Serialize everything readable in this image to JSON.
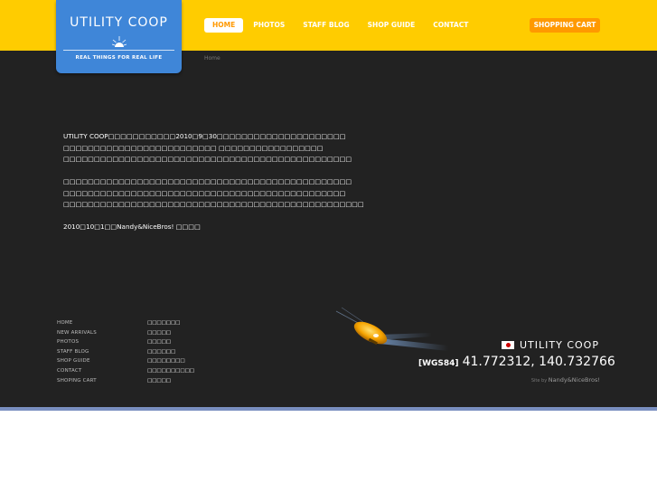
{
  "logo": {
    "title": "UTILITY COOP",
    "tagline": "REAL THINGS FOR REAL LIFE"
  },
  "nav": {
    "items": [
      {
        "label": "HOME",
        "active": true
      },
      {
        "label": "PHOTOS",
        "active": false
      },
      {
        "label": "STAFF BLOG",
        "active": false
      },
      {
        "label": "SHOP GUIDE",
        "active": false
      },
      {
        "label": "CONTACT",
        "active": false
      }
    ],
    "cart_label": "SHOPPING CART"
  },
  "breadcrumb": "Home",
  "content": {
    "lines": [
      "UTILITY COOP□□□□□□□□□□□2010□9□30□□□□□□□□□□□□□□□□□□□□□",
      "□□□□□□□□□□□□□□□□□□□□□□□□□ □□□□□□□□□□□□□□□□□",
      "□□□□□□□□□□□□□□□□□□□□□□□□□□□□□□□□□□□□□□□□□□□□□□□",
      "□□□□□□□□□□□□□□□□□□□□□□□□□□□□□□□□□□□□□□□□□□□□□□□",
      "□□□□□□□□□□□□□□□□□□□□□□□□□□□□□□□□□□□□□□□□□□□□□□",
      "□□□□□□□□□□□□□□□□□□□□□□□□□□□□□□□□□□□□□□□□□□□□□□□□□",
      "2010□10□1□□Nandy&NiceBros! □□□□"
    ]
  },
  "footer": {
    "links": [
      "HOME",
      "NEW ARRIVALS",
      "PHOTOS",
      "STAFF BLOG",
      "SHOP GUIDE",
      "CONTACT",
      "SHOPING CART"
    ],
    "links_ja": [
      "□□□□□□□",
      "□□□□□",
      "□□□□□",
      "□□□□□□",
      "□□□□□□□□",
      "□□□□□□□□□□",
      "□□□□□"
    ],
    "brand_name": "UTILITY COOP",
    "datum": "[WGS84]",
    "coordinates": "41.772312, 140.732766",
    "credit_prefix": "Site by",
    "credit_maker": "Nandy&NiceBros!"
  },
  "colors": {
    "header": "#ffcc00",
    "logo_bg": "#3f86d8",
    "cart": "#ff9900",
    "main_bg": "#222222"
  }
}
